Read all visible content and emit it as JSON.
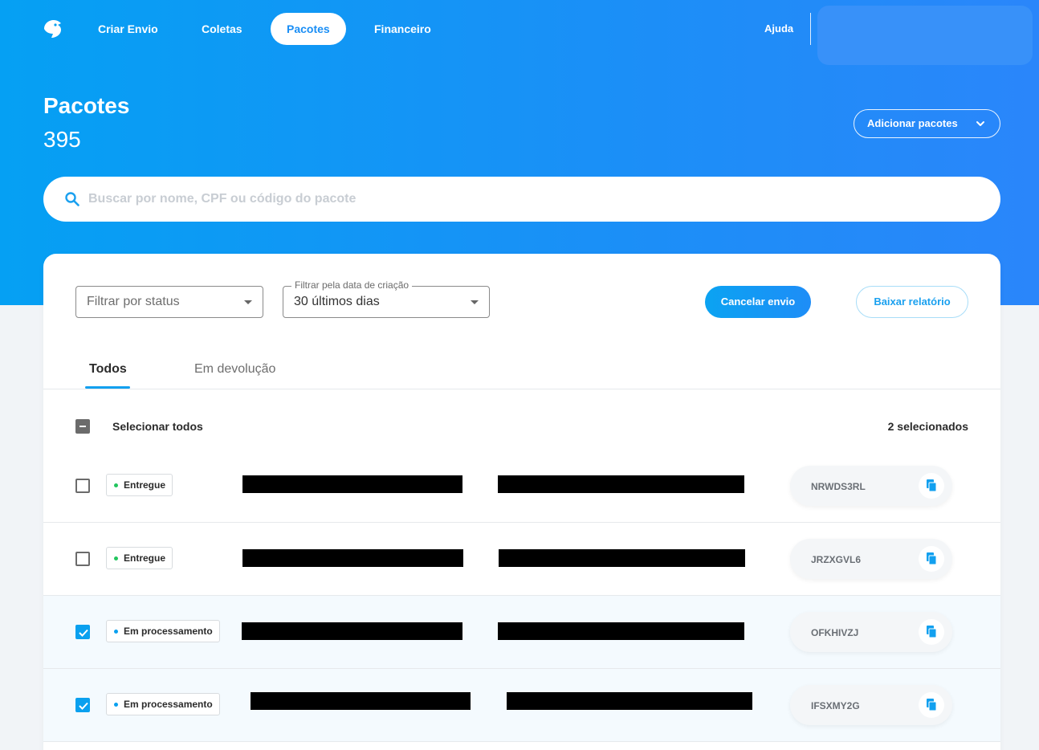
{
  "nav": {
    "items": [
      {
        "label": "Criar Envio"
      },
      {
        "label": "Coletas"
      },
      {
        "label": "Pacotes"
      },
      {
        "label": "Financeiro"
      }
    ],
    "help_label": "Ajuda"
  },
  "header": {
    "title": "Pacotes",
    "count": "395",
    "add_button": "Adicionar pacotes"
  },
  "search": {
    "placeholder": "Buscar por nome, CPF ou código do pacote"
  },
  "filters": {
    "status_placeholder": "Filtrar por status",
    "date_label": "Filtrar pela data de criação",
    "date_value": "30 últimos dias"
  },
  "actions": {
    "cancel": "Cancelar envio",
    "report": "Baixar relatório"
  },
  "tabs": [
    {
      "label": "Todos"
    },
    {
      "label": "Em devolução"
    }
  ],
  "selection": {
    "select_all": "Selecionar todos",
    "count": "2 selecionados"
  },
  "colors": {
    "accent": "#0aa0ef",
    "status_delivered": "#22c55e",
    "status_processing": "#0aa0ef"
  },
  "packages": [
    {
      "status": "Entregue",
      "code": "NRWDS3RL",
      "selected": false
    },
    {
      "status": "Entregue",
      "code": "JRZXGVL6",
      "selected": false
    },
    {
      "status": "Em processamento",
      "code": "OFKHIVZJ",
      "selected": true
    },
    {
      "status": "Em processamento",
      "code": "IFSXMY2G",
      "selected": true
    }
  ]
}
